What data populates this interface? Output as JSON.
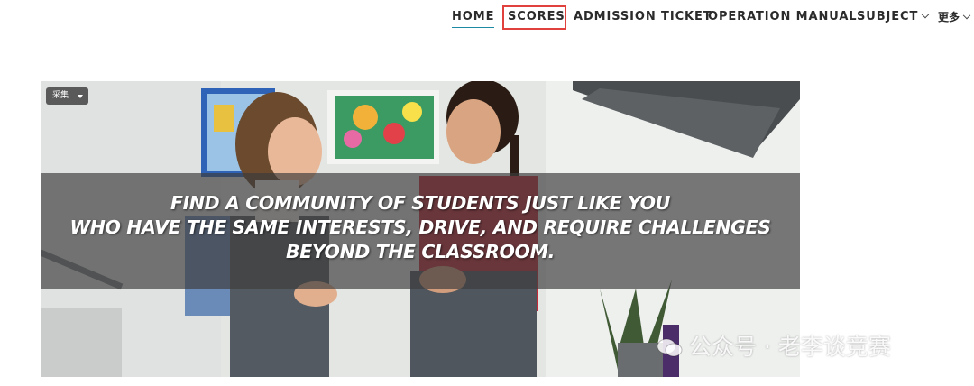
{
  "nav": {
    "items": [
      {
        "label": "HOME",
        "active": true
      },
      {
        "label": "SCORES",
        "highlighted": true
      },
      {
        "label": "ADMISSION TICKET"
      },
      {
        "label": "OPERATION MANUAL"
      },
      {
        "label": "SUBJECT",
        "has_dropdown": true
      },
      {
        "label": "更多",
        "has_dropdown": true
      }
    ],
    "active_underline_color": "#1c8aa3",
    "highlight_color": "#e0413d"
  },
  "hero": {
    "collect_badge": "采集",
    "tagline": [
      "FIND A COMMUNITY OF STUDENTS JUST LIKE YOU",
      "WHO HAVE THE SAME INTERESTS, DRIVE, AND REQUIRE CHALLENGES",
      "BEYOND THE CLASSROOM."
    ]
  },
  "watermark": {
    "text": "公众号 · 老李谈竞赛",
    "icon": "wechat-icon"
  }
}
